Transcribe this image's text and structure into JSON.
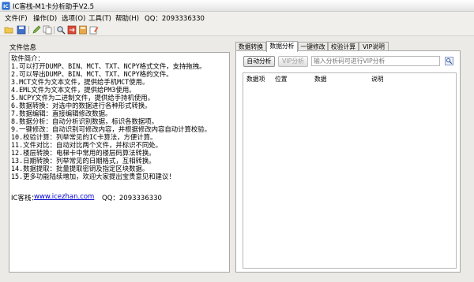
{
  "window": {
    "title": "IC客栈-M1卡分析助手V2.5"
  },
  "menu": {
    "items": [
      {
        "label": "文件(F)"
      },
      {
        "label": "操作(D)"
      },
      {
        "label": "选项(O)"
      },
      {
        "label": "工具(T)"
      },
      {
        "label": "帮助(H)"
      }
    ],
    "qq": "QQ：2093336330"
  },
  "toolbar": {
    "icons": [
      "open-folder-icon",
      "save-icon",
      "edit-icon",
      "copy-icon",
      "search-icon",
      "convert-icon",
      "calculator-icon",
      "edit-data-icon"
    ]
  },
  "left": {
    "header": "文件信息",
    "lines": [
      "软件简介：",
      "1.可以打开DUMP、BIN、MCT、TXT、NCPY格式文件，支持拖拽。",
      "2.可以导出DUMP、BIN、MCT、TXT、NCPY格的文件。",
      "3.MCT文件为文本文件，提供给手机MCT使用。",
      "4.EML文件为文本文件，提供给PM3使用。",
      "5.NCPY文件为二进制文件，提供给手持机使用。",
      "6.数据转换：对选中的数据进行各种形式转换。",
      "7.数据编辑：直接编辑修改数据。",
      "8.数据分析：自动分析识别数据，标识各数据项。",
      "9.一键修改：自动识别可修改内容，并根据修改内容自动计算校验。",
      "10.校验计算：列举常见的IC卡算法，方便计算。",
      "11.文件对比：自动对比两个文件，并标识不同处。",
      "12.楼层转换：电梯卡中常用的楼层码算法转换。",
      "13.日期转换：列举常见的日期格式，互相转换。",
      "14.数据提取：批量提取密钥及指定区块数据。",
      "15.更多功能陆续增加，欢迎大家提出宝贵意见和建议！"
    ],
    "lead": {
      "label": "IC客栈：",
      "link": "www.icezhan.com",
      "qq": "QQ：2093336330"
    }
  },
  "right": {
    "tabs": [
      {
        "label": "数据转换"
      },
      {
        "label": "数据分析"
      },
      {
        "label": "一键修改"
      },
      {
        "label": "校验计算"
      },
      {
        "label": "VIP说明"
      }
    ],
    "auto_button": "自动分析",
    "vip_button": "VIP分析",
    "vip_placeholder": "输入分析码可进行VIP分析",
    "columns": [
      {
        "label": "数据项"
      },
      {
        "label": "位置"
      },
      {
        "label": "数据"
      },
      {
        "label": "说明"
      }
    ]
  }
}
